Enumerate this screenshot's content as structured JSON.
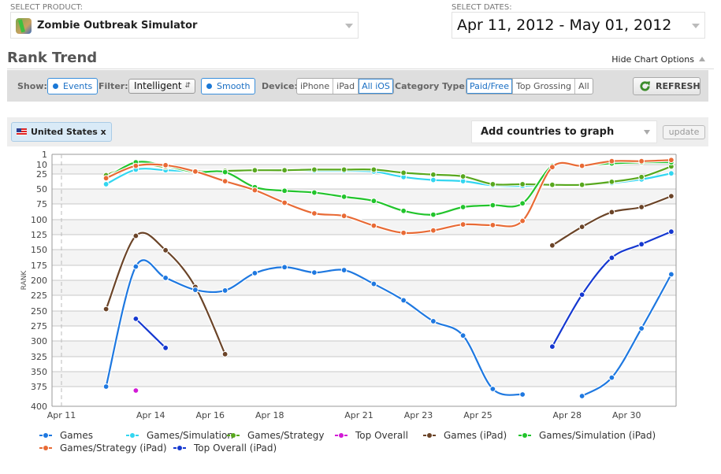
{
  "product": {
    "label": "SELECT PRODUCT:",
    "name": "Zombie Outbreak Simulator"
  },
  "dates": {
    "label": "SELECT DATES:",
    "value": "Apr 11, 2012 - May 01, 2012"
  },
  "page": {
    "title": "Rank Trend",
    "hide_options": "Hide Chart Options"
  },
  "options": {
    "show_label": "Show:",
    "events": "Events",
    "filter_label": "Filter:",
    "filter_value": "Intelligent",
    "smooth": "Smooth",
    "device_label": "Device:",
    "devices": [
      {
        "label": "iPhone",
        "active": false
      },
      {
        "label": "iPad",
        "active": false
      },
      {
        "label": "All iOS",
        "active": true
      }
    ],
    "category_label": "Category Type:",
    "categories": [
      {
        "label": "Paid/Free",
        "active": true
      },
      {
        "label": "Top Grossing",
        "active": false
      },
      {
        "label": "All",
        "active": false
      }
    ],
    "refresh": "REFRESH"
  },
  "countries": {
    "selected": "United States x",
    "add_placeholder": "Add countries to graph",
    "update": "update"
  },
  "chart_data": {
    "type": "line",
    "title": "",
    "xlabel": "",
    "ylabel": "RANK",
    "y_reversed": true,
    "yticks": [
      1,
      10,
      25,
      50,
      75,
      100,
      125,
      150,
      175,
      200,
      225,
      250,
      275,
      300,
      325,
      350,
      375,
      400
    ],
    "ylim": [
      1,
      400
    ],
    "x_tick_labels": [
      "Apr 11",
      "Apr 14",
      "Apr 16",
      "Apr 18",
      "Apr 21",
      "Apr 23",
      "Apr 25",
      "Apr 28",
      "Apr 30"
    ],
    "x_tick_days": [
      0,
      3,
      5,
      7,
      10,
      12,
      14,
      17,
      19
    ],
    "x_start": "Apr 11",
    "x": [
      "Apr 12",
      "Apr 13",
      "Apr 14",
      "Apr 15",
      "Apr 16",
      "Apr 17",
      "Apr 18",
      "Apr 19",
      "Apr 20",
      "Apr 21",
      "Apr 22",
      "Apr 23",
      "Apr 24",
      "Apr 25",
      "Apr 26",
      "Apr 27",
      "Apr 28",
      "Apr 29",
      "Apr 30",
      "May 01"
    ],
    "grid": true,
    "legend_position": "bottom",
    "series": [
      {
        "name": "Games",
        "color": "#1e78e0",
        "values": [
          375,
          177,
          196,
          216,
          217,
          188,
          178,
          187,
          183,
          206,
          233,
          267,
          291,
          378,
          385,
          null,
          387,
          360,
          279,
          190
        ]
      },
      {
        "name": "Games/Simulation",
        "color": "#33d6f0",
        "values": [
          42,
          18,
          19,
          21,
          21,
          19,
          19,
          20,
          20,
          21,
          30,
          35,
          37,
          44,
          45,
          43,
          43,
          40,
          34,
          24
        ]
      },
      {
        "name": "Games/Strategy",
        "color": "#58a81e",
        "values": [
          27,
          10,
          14,
          20,
          20,
          19,
          19,
          18,
          18,
          18,
          23,
          26,
          29,
          42,
          42,
          43,
          43,
          38,
          30,
          13
        ]
      },
      {
        "name": "Top Overall",
        "color": "#d21ad6",
        "values": [
          null,
          380,
          null,
          null,
          null,
          null,
          null,
          null,
          null,
          null,
          null,
          null,
          null,
          null,
          null,
          null,
          null,
          null,
          null,
          null
        ]
      },
      {
        "name": "Games (iPad)",
        "color": "#6b4428",
        "values": [
          247,
          127,
          151,
          211,
          321,
          null,
          null,
          null,
          null,
          null,
          null,
          null,
          null,
          null,
          null,
          143,
          112,
          88,
          80,
          62
        ]
      },
      {
        "name": "Games/Simulation (iPad)",
        "color": "#22c42c",
        "values": [
          32,
          8,
          12,
          22,
          22,
          47,
          53,
          56,
          63,
          70,
          86,
          92,
          80,
          77,
          74,
          12,
          11,
          9,
          8,
          8
        ]
      },
      {
        "name": "Games/Strategy (iPad)",
        "color": "#e86a35",
        "values": [
          32,
          12,
          11,
          21,
          37,
          52,
          73,
          90,
          94,
          110,
          122,
          118,
          108,
          109,
          102,
          14,
          12,
          7,
          7,
          6
        ]
      },
      {
        "name": "Top Overall (iPad)",
        "color": "#1538d0",
        "values": [
          null,
          263,
          311,
          null,
          null,
          null,
          null,
          null,
          null,
          null,
          null,
          null,
          null,
          null,
          null,
          309,
          224,
          163,
          141,
          120
        ]
      }
    ]
  }
}
